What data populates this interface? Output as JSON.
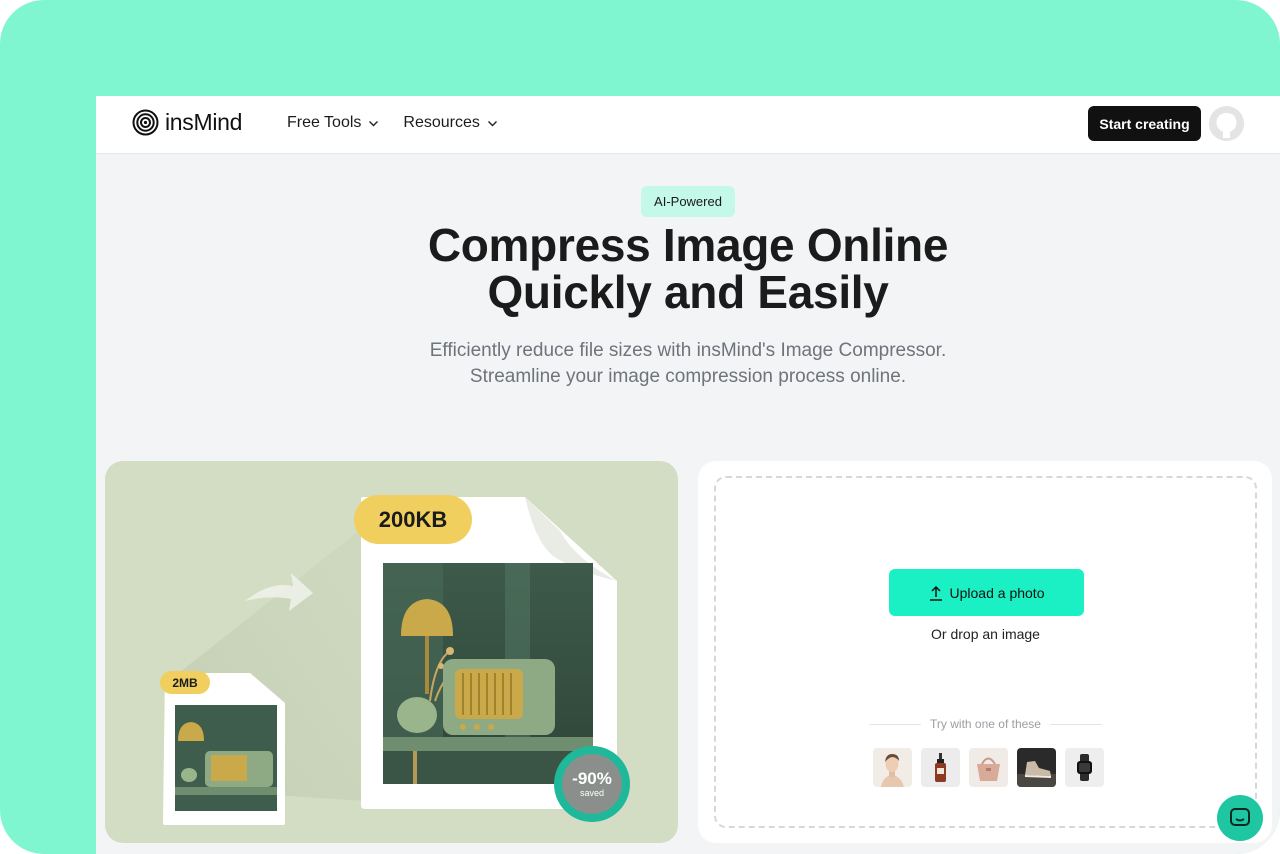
{
  "brand": {
    "name": "insMind",
    "logo_icon": "spiral-logo-icon"
  },
  "nav": {
    "items": [
      {
        "label": "Free Tools",
        "icon": "chevron-down-icon"
      },
      {
        "label": "Resources",
        "icon": "chevron-down-icon"
      }
    ],
    "cta_label": "Start creating",
    "avatar_icon": "github-avatar-icon"
  },
  "hero": {
    "badge": "AI-Powered",
    "title_line1": "Compress Image Online",
    "title_line2": "Quickly and Easily",
    "subtitle": "Efficiently reduce file sizes with insMind's Image Compressor. Streamline your image compression process online."
  },
  "illustration": {
    "big_size": "200KB",
    "small_size": "2MB",
    "saved_percent": "-90%",
    "saved_label": "saved",
    "colors": {
      "background": "#d3ddc4",
      "tag": "#f0cf5e",
      "ring": "#1fb89a"
    }
  },
  "upload": {
    "button_label": "Upload a photo",
    "button_icon": "upload-arrow-icon",
    "drop_text": "Or drop an image",
    "try_text": "Try with one of these",
    "samples": [
      "woman-portrait",
      "serum-bottle",
      "handbag",
      "sneaker",
      "smartwatch"
    ]
  },
  "colors": {
    "accent": "#1af0c3",
    "frame": "#7ff5d0",
    "dark": "#111111"
  },
  "chat": {
    "icon": "chat-bubble-icon"
  }
}
